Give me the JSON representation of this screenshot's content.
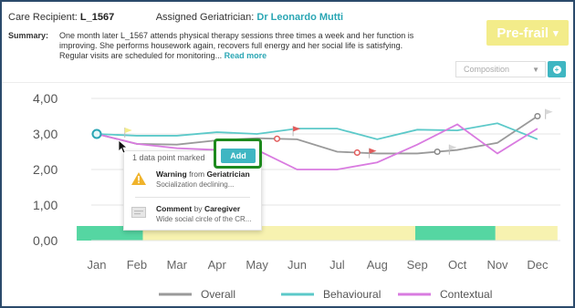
{
  "header": {
    "recipient_label": "Care Recipient:",
    "recipient_id": "L_1567",
    "geriatrician_label": "Assigned Geriatrician:",
    "geriatrician_name": "Dr Leonardo Mutti"
  },
  "summary": {
    "label": "Summary:",
    "text": "One month later L_1567 attends physical therapy sessions three times a week and her function is improving. She performs  housework again, recovers full energy and her social life is satisfying. Regular visits are scheduled for monitoring...",
    "read_more": "Read more"
  },
  "frailty": {
    "label": "Pre-frail",
    "caret": "▾",
    "color": "#f3ec8a"
  },
  "composition_select": {
    "selected": "Composition",
    "caret": "▼",
    "button_icon": "plus-circle-icon"
  },
  "colors": {
    "overall": "#9a9a9a",
    "behavioural": "#5cc9c9",
    "contextual": "#d97be0",
    "band_green": "#55d6a2",
    "band_yellow": "#f7f2b0",
    "flag_red": "#e15b5b",
    "flag_gray": "#d8d8d8",
    "flag_yellow": "#f3ec8a",
    "accent": "#3fb6c2",
    "highlight_green": "#1e8a1e"
  },
  "chart_data": {
    "type": "line",
    "categories": [
      "Jan",
      "Feb",
      "Mar",
      "Apr",
      "May",
      "Jun",
      "Jul",
      "Aug",
      "Sep",
      "Oct",
      "Nov",
      "Dec"
    ],
    "ylim": [
      0,
      4.2
    ],
    "yticks": [
      "0,00",
      "1,00",
      "2,00",
      "3,00",
      "4,00"
    ],
    "ytick_values": [
      0,
      1,
      2,
      3,
      4
    ],
    "legend_position": "bottom",
    "series": [
      {
        "name": "Overall",
        "color": "#9a9a9a",
        "values": [
          3.0,
          2.72,
          2.7,
          2.82,
          2.88,
          2.85,
          2.5,
          2.45,
          2.45,
          2.55,
          2.75,
          3.5
        ]
      },
      {
        "name": "Behavioural",
        "color": "#5cc9c9",
        "values": [
          3.0,
          2.95,
          2.95,
          3.05,
          3.0,
          3.15,
          3.15,
          2.85,
          3.12,
          3.1,
          3.3,
          2.85
        ]
      },
      {
        "name": "Contextual",
        "color": "#d97be0",
        "values": [
          3.0,
          2.72,
          2.6,
          2.55,
          2.55,
          2.0,
          2.0,
          2.2,
          2.7,
          3.27,
          2.45,
          3.15
        ]
      }
    ],
    "markers": [
      {
        "series": "Overall",
        "month": 1,
        "style": "selected"
      },
      {
        "series": "Overall",
        "month": 5.5,
        "style": "red"
      },
      {
        "series": "Overall",
        "month": 7.5,
        "style": "red"
      },
      {
        "series": "Overall",
        "month": 9.5,
        "style": "gray"
      },
      {
        "series": "Overall",
        "month": 12,
        "style": "gray"
      }
    ],
    "flags": [
      {
        "month": 1.7,
        "value": 3.18,
        "color": "yellow"
      },
      {
        "month": 5.9,
        "value": 3.22,
        "color": "red"
      },
      {
        "month": 7.8,
        "value": 2.6,
        "color": "red"
      },
      {
        "month": 9.8,
        "value": 2.7,
        "color": "gray"
      },
      {
        "month": 12.2,
        "value": 3.7,
        "color": "gray"
      }
    ],
    "status_band": [
      {
        "from": 0.5,
        "to": 2.15,
        "status": "green"
      },
      {
        "from": 2.15,
        "to": 8.95,
        "status": "yellow"
      },
      {
        "from": 8.95,
        "to": 10.95,
        "status": "green"
      },
      {
        "from": 10.95,
        "to": 12.5,
        "status": "yellow"
      }
    ]
  },
  "popup": {
    "title": "1 data point marked",
    "items": [
      {
        "kind": "Warning",
        "from_label": "from",
        "author": "Geriatrician",
        "detail": "Socialization declining...",
        "icon": "warning-icon"
      },
      {
        "kind": "Comment",
        "from_label": "by",
        "author": "Caregiver",
        "detail": "Wide social circle of the CR...",
        "icon": "comment-icon"
      }
    ],
    "add_label": "Add"
  }
}
